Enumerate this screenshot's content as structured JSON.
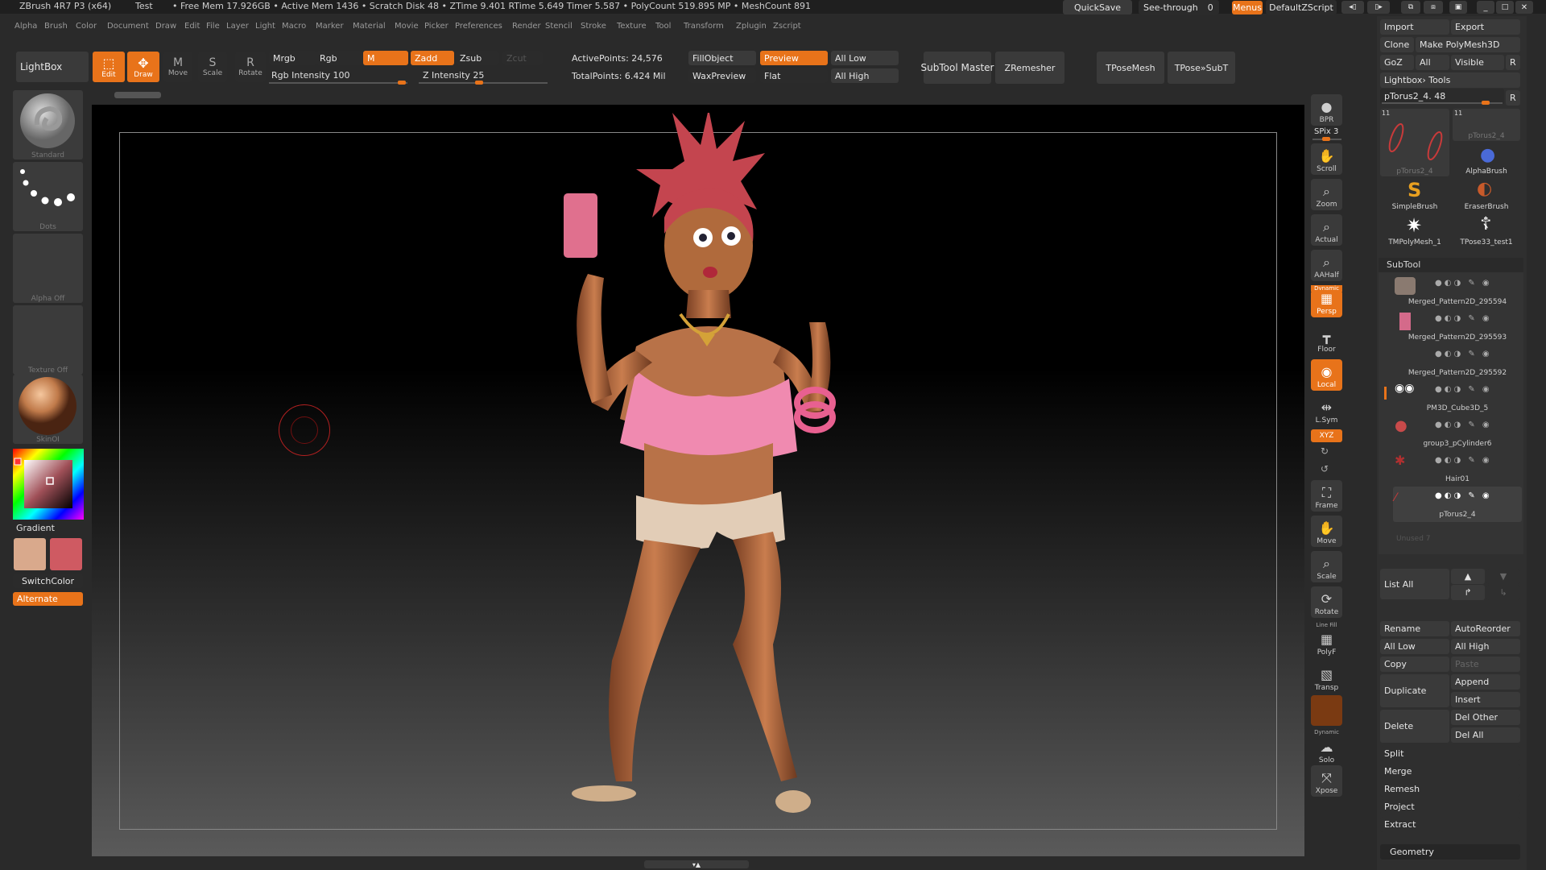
{
  "titlebar": {
    "app": "ZBrush 4R7 P3 (x64)",
    "doc": "Test",
    "stats": "• Free Mem 17.926GB • Active Mem 1436 • Scratch Disk 48 • ZTime 9.401 RTime 5.649 Timer 5.587 • PolyCount 519.895 MP • MeshCount 891",
    "quicksave": "QuickSave",
    "seethrough": "See-through",
    "seethrough_val": "0",
    "menus": "Menus",
    "script": "DefaultZScript"
  },
  "menu": [
    "Alpha",
    "Brush",
    "Color",
    "Document",
    "Draw",
    "Edit",
    "File",
    "Layer",
    "Light",
    "Macro",
    "Marker",
    "Material",
    "Movie",
    "Picker",
    "Preferences",
    "Render",
    "Stencil",
    "Stroke",
    "Texture",
    "Tool",
    "Transform",
    "Zplugin",
    "Zscript"
  ],
  "toolbar": {
    "lightbox": "LightBox",
    "edit": "Edit",
    "draw": "Draw",
    "move": "Move",
    "scale": "Scale",
    "rotate": "Rotate",
    "mrgb": "Mrgb",
    "rgb": "Rgb",
    "m": "M",
    "zadd": "Zadd",
    "zsub": "Zsub",
    "zcut": "Zcut",
    "rgb_intensity": "Rgb Intensity 100",
    "z_intensity": "Z Intensity 25",
    "active_points": "ActivePoints: 24,576",
    "total_points": "TotalPoints: 6.424 Mil",
    "fill_object": "FillObject",
    "preview": "Preview",
    "wax_preview": "WaxPreview",
    "flat": "Flat",
    "all_low": "All Low",
    "all_high": "All High",
    "subtool_master": "SubTool Master",
    "zremesher": "ZRemesher",
    "tposemesh": "TPoseMesh",
    "tpose_subt": "TPose»SubT"
  },
  "left": {
    "brush": "Standard",
    "stroke": "Dots",
    "alpha": "Alpha Off",
    "texture": "Texture Off",
    "material": "SkinOI",
    "gradient": "Gradient",
    "switchcolor": "SwitchColor",
    "alternate": "Alternate",
    "color_main": "#d9a98c",
    "color_secondary": "#cf5a62"
  },
  "right_tools": [
    "BPR",
    "SPix 3",
    "Scroll",
    "Zoom",
    "Actual",
    "AAHalf",
    "Persp",
    "Floor",
    "Local",
    "L.Sym",
    "XYZ",
    "Frame",
    "Move",
    "Scale",
    "Rotate",
    "PolyF",
    "Transp",
    "Solo",
    "Xpose"
  ],
  "right_top_labels": {
    "dynamic": "Dynamic",
    "line_fill": "Line Fill",
    "dynamic2": "Dynamic"
  },
  "tool": {
    "import": "Import",
    "export": "Export",
    "clone": "Clone",
    "make_polymesh": "Make PolyMesh3D",
    "goz": "GoZ",
    "all": "All",
    "visible": "Visible",
    "r": "R",
    "lightbox_tools": "Lightbox› Tools",
    "current": "pTorus2_4. 48",
    "thumbs": [
      {
        "label": "pTorus2_4",
        "count": "11"
      },
      {
        "label": "pTorus2_4",
        "count": "11"
      },
      {
        "label": "AlphaBrush"
      },
      {
        "label": "SimpleBrush"
      },
      {
        "label": "EraserBrush"
      },
      {
        "label": "TMPolyMesh_1"
      },
      {
        "label": "TPose33_test1"
      }
    ]
  },
  "subtool": {
    "title": "SubTool",
    "items": [
      "Merged_Pattern2D_295594",
      "Merged_Pattern2D_295593",
      "Merged_Pattern2D_295592",
      "PM3D_Cube3D_5",
      "group3_pCylinder6",
      "Hair01",
      "pTorus2_4"
    ],
    "unused": "Unused 7",
    "list_all": "List All",
    "rename": "Rename",
    "autoreorder": "AutoReorder",
    "all_low": "All Low",
    "all_high": "All High",
    "copy": "Copy",
    "paste": "Paste",
    "duplicate": "Duplicate",
    "append": "Append",
    "insert": "Insert",
    "delete": "Delete",
    "del_other": "Del Other",
    "del_all": "Del All",
    "split": "Split",
    "merge": "Merge",
    "remesh": "Remesh",
    "project": "Project",
    "extract": "Extract",
    "geometry": "Geometry"
  }
}
